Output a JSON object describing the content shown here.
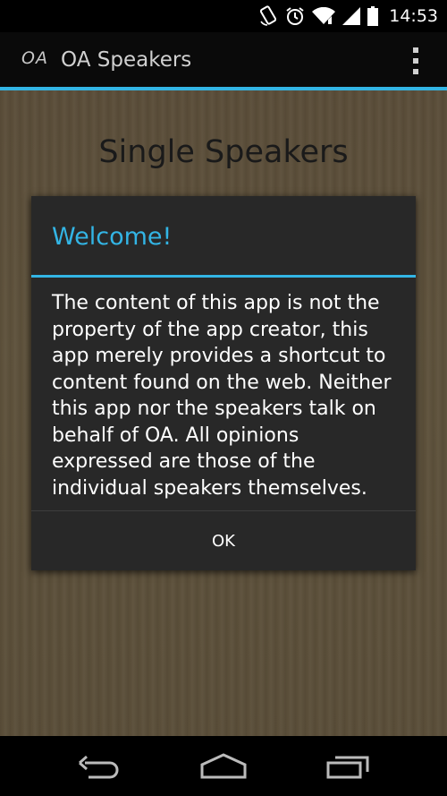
{
  "status_bar": {
    "time": "14:53",
    "icons": [
      "rotation-icon",
      "alarm-icon",
      "wifi-icon",
      "signal-icon",
      "battery-icon"
    ]
  },
  "action_bar": {
    "logo_text": "OA",
    "title": "OA Speakers",
    "overflow_icon": "overflow-menu-icon"
  },
  "content": {
    "heading": "Single Speakers"
  },
  "dialog": {
    "title": "Welcome!",
    "message": "The content of this app is not the property of the app creator, this app merely provides a shortcut to content found on the web. Neither this app nor the speakers talk on behalf of OA. All opinions expressed are those of the individual speakers themselves.",
    "ok_label": "OK"
  },
  "nav_bar": {
    "icons": [
      "back-icon",
      "home-icon",
      "recents-icon"
    ]
  },
  "colors": {
    "accent": "#33b5e5",
    "dialog_bg": "#282828",
    "wood": "#5c4f3a"
  }
}
